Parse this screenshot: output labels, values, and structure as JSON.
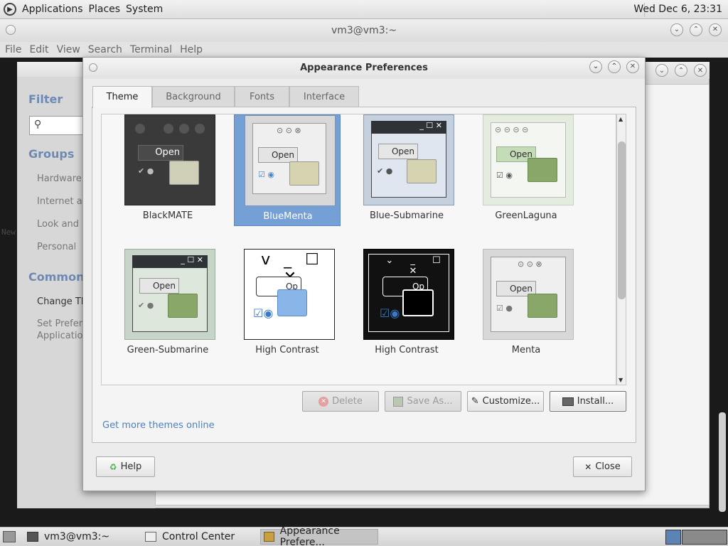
{
  "top_panel": {
    "menus": [
      "Applications",
      "Places",
      "System"
    ],
    "clock": "Wed Dec 6, 23:31"
  },
  "terminal": {
    "title": "vm3@vm3:~",
    "menu": [
      "File",
      "Edit",
      "View",
      "Search",
      "Terminal",
      "Help"
    ],
    "bg_fragment": "New"
  },
  "control_center": {
    "filter_title": "Filter",
    "groups_title": "Groups",
    "groups": [
      "Hardware",
      "Internet ar",
      "Look and F",
      "Personal"
    ],
    "common_title": "Common T",
    "common_items": [
      "Change Th",
      "Set Prefere",
      "Applicatio"
    ]
  },
  "dialog": {
    "title": "Appearance Preferences",
    "tabs": [
      "Theme",
      "Background",
      "Fonts",
      "Interface"
    ],
    "active_tab": "Theme",
    "themes": [
      {
        "name": "BlackMATE",
        "selected": false,
        "thumb_label": "Open"
      },
      {
        "name": "BlueMenta",
        "selected": true,
        "thumb_label": "Open"
      },
      {
        "name": "Blue-Submarine",
        "selected": false,
        "thumb_label": "Open"
      },
      {
        "name": "GreenLaguna",
        "selected": false,
        "thumb_label": "Open"
      },
      {
        "name": "Green-Submarine",
        "selected": false,
        "thumb_label": "Open"
      },
      {
        "name": "High Contrast",
        "selected": false,
        "thumb_label": "Op"
      },
      {
        "name": "High Contrast",
        "selected": false,
        "thumb_label": "Op"
      },
      {
        "name": "Menta",
        "selected": false,
        "thumb_label": "Open"
      }
    ],
    "buttons": {
      "delete": "Delete",
      "save_as": "Save As...",
      "customize": "Customize...",
      "install": "Install...",
      "help": "Help",
      "close": "Close"
    },
    "link": "Get more themes online"
  },
  "taskbar": {
    "tasks": [
      "vm3@vm3:~",
      "Control Center",
      "Appearance Prefere..."
    ]
  }
}
